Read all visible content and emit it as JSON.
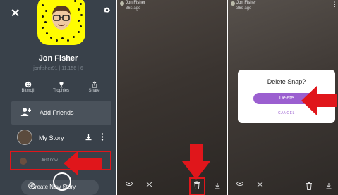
{
  "profile": {
    "name": "Jon Fisher",
    "username": "jonfisher91 | 11,156 | 6"
  },
  "quick_actions": [
    {
      "label": "Bitmoji",
      "icon": "bitmoji-icon"
    },
    {
      "label": "Trophies",
      "icon": "trophy-icon"
    },
    {
      "label": "Share",
      "icon": "share-icon"
    }
  ],
  "add_friends": {
    "label": "Add Friends"
  },
  "my_story": {
    "label": "My Story"
  },
  "snap_row": {
    "time": "Just now"
  },
  "create_story": {
    "label": "Create New Story"
  },
  "viewer_header": {
    "name": "Jon Fisher",
    "time": "36s ago"
  },
  "dialog": {
    "title": "Delete Snap?",
    "delete_label": "Delete",
    "cancel_label": "CANCEL"
  },
  "colors": {
    "highlight": "#e0161b",
    "accent": "#9b5fd0",
    "snapcode": "#fffc00"
  }
}
